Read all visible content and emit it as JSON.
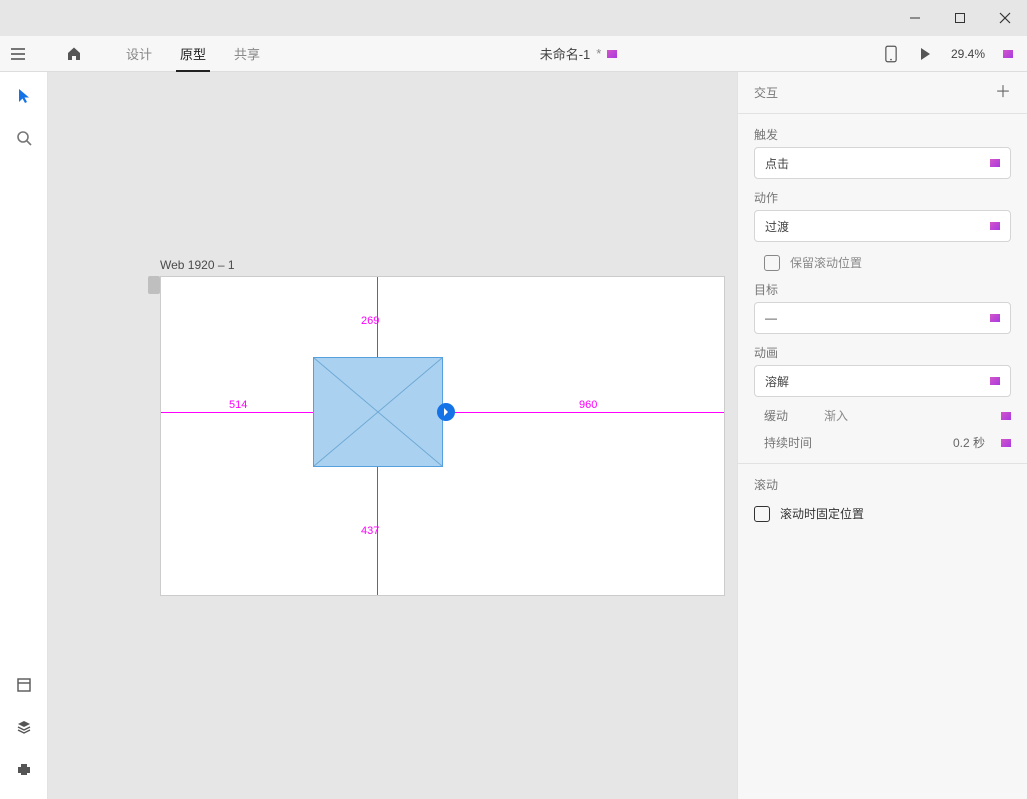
{
  "window": {
    "title": "未命名-1",
    "modified": "*"
  },
  "header": {
    "tabs": [
      "设计",
      "原型",
      "共享"
    ],
    "active_tab_index": 1,
    "zoom": "29.4%"
  },
  "tools": {
    "select": "select-tool",
    "search": "search-tool",
    "libraries": "libraries",
    "layers": "layers",
    "plugins": "plugins"
  },
  "canvas": {
    "artboard_label": "Web 1920 – 1",
    "dims": {
      "top": "269",
      "bottom": "437",
      "left": "514",
      "right": "960"
    }
  },
  "panel": {
    "interaction_header": "交互",
    "trigger_label": "触发",
    "trigger_value": "点击",
    "action_label": "动作",
    "action_value": "过渡",
    "preserve_scroll_label": "保留滚动位置",
    "destination_label": "目标",
    "destination_value": "—",
    "animation_label": "动画",
    "animation_value": "溶解",
    "easing_label": "缓动",
    "easing_value": "渐入",
    "duration_label": "持续时间",
    "duration_value": "0.2 秒",
    "scroll_header": "滚动",
    "fix_on_scroll_label": "滚动时固定位置"
  }
}
